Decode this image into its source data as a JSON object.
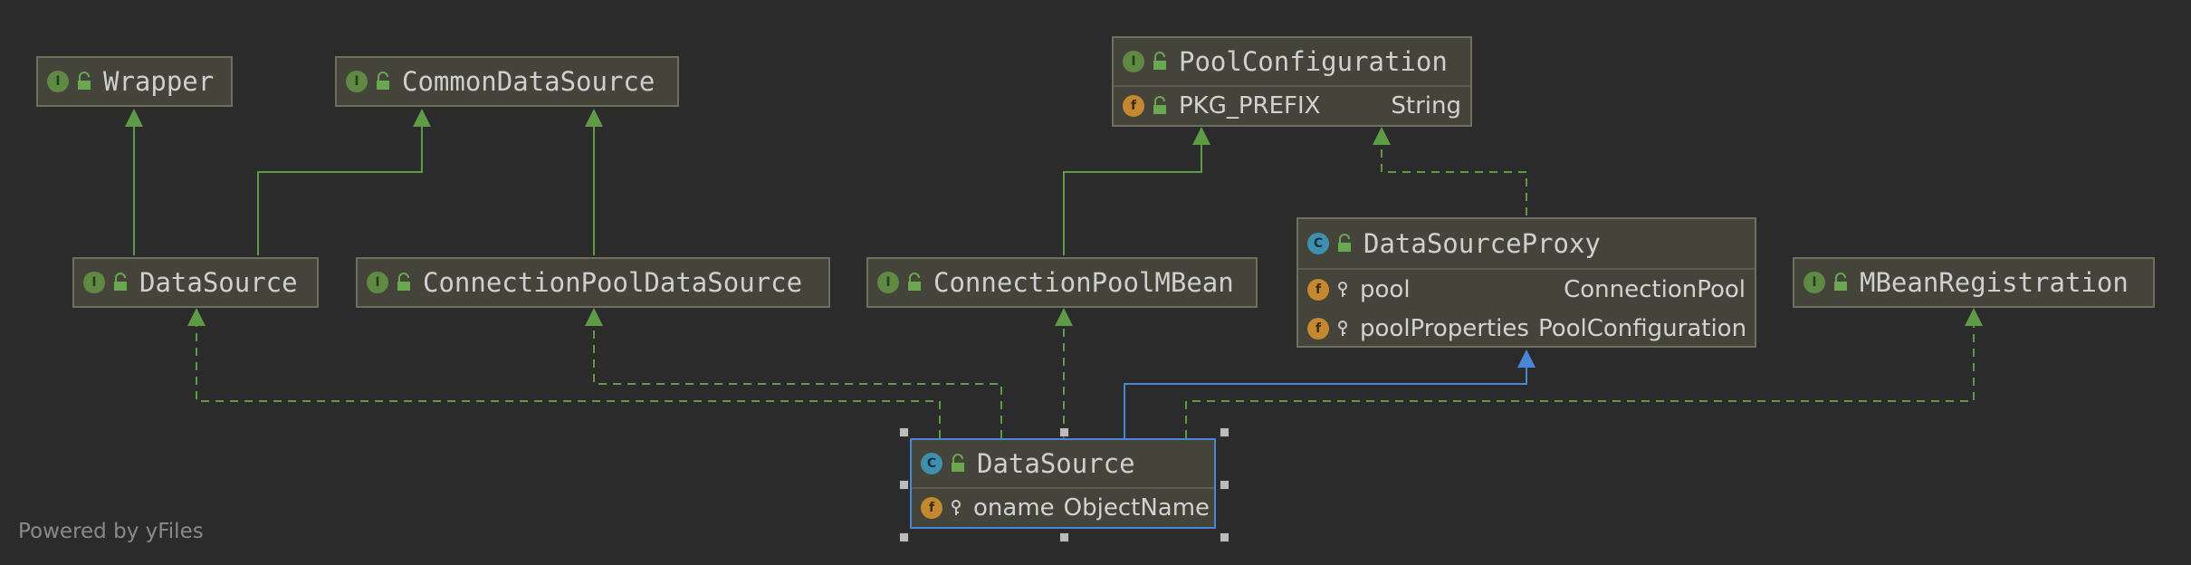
{
  "diagram": {
    "nodes": {
      "wrapper": {
        "kind": "interface",
        "name": "Wrapper",
        "badge": "I"
      },
      "common_data_source": {
        "kind": "interface",
        "name": "CommonDataSource",
        "badge": "I"
      },
      "pool_configuration": {
        "kind": "interface",
        "name": "PoolConfiguration",
        "badge": "I",
        "fields": [
          {
            "badge": "f",
            "name": "PKG_PREFIX",
            "type": "String"
          }
        ]
      },
      "data_source_iface": {
        "kind": "interface",
        "name": "DataSource",
        "badge": "I"
      },
      "connection_pool_data_source": {
        "kind": "interface",
        "name": "ConnectionPoolDataSource",
        "badge": "I"
      },
      "connection_pool_mbean": {
        "kind": "interface",
        "name": "ConnectionPoolMBean",
        "badge": "I"
      },
      "data_source_proxy": {
        "kind": "class",
        "name": "DataSourceProxy",
        "badge": "C",
        "fields": [
          {
            "badge": "f",
            "name": "pool",
            "type": "ConnectionPool"
          },
          {
            "badge": "f",
            "name": "poolProperties",
            "type": "PoolConfiguration"
          }
        ]
      },
      "mbean_registration": {
        "kind": "interface",
        "name": "MBeanRegistration",
        "badge": "I"
      },
      "data_source_class": {
        "kind": "class",
        "name": "DataSource",
        "badge": "C",
        "selected": true,
        "fields": [
          {
            "badge": "f",
            "name": "oname",
            "type": "ObjectName"
          }
        ]
      }
    },
    "edges": [
      {
        "from": "data_source_iface",
        "to": "wrapper",
        "style": "extends"
      },
      {
        "from": "data_source_iface",
        "to": "common_data_source",
        "style": "extends"
      },
      {
        "from": "connection_pool_data_source",
        "to": "common_data_source",
        "style": "extends"
      },
      {
        "from": "connection_pool_mbean",
        "to": "pool_configuration",
        "style": "extends"
      },
      {
        "from": "data_source_proxy",
        "to": "pool_configuration",
        "style": "implements"
      },
      {
        "from": "data_source_class",
        "to": "data_source_iface",
        "style": "implements"
      },
      {
        "from": "data_source_class",
        "to": "connection_pool_data_source",
        "style": "implements"
      },
      {
        "from": "data_source_class",
        "to": "connection_pool_mbean",
        "style": "implements"
      },
      {
        "from": "data_source_class",
        "to": "data_source_proxy",
        "style": "extends-selected"
      },
      {
        "from": "data_source_class",
        "to": "mbean_registration",
        "style": "implements"
      }
    ],
    "colors": {
      "background": "#2b2b2b",
      "node_fill": "#45443a",
      "node_border": "#6f6e5f",
      "selected_border": "#4a86d6",
      "edge_green": "#5f9a47",
      "edge_blue": "#4a86d6",
      "interface_badge": "#5f8a43",
      "class_badge": "#3f8fb0",
      "field_badge": "#c4892f"
    }
  },
  "footer": {
    "text": "Powered by yFiles"
  }
}
